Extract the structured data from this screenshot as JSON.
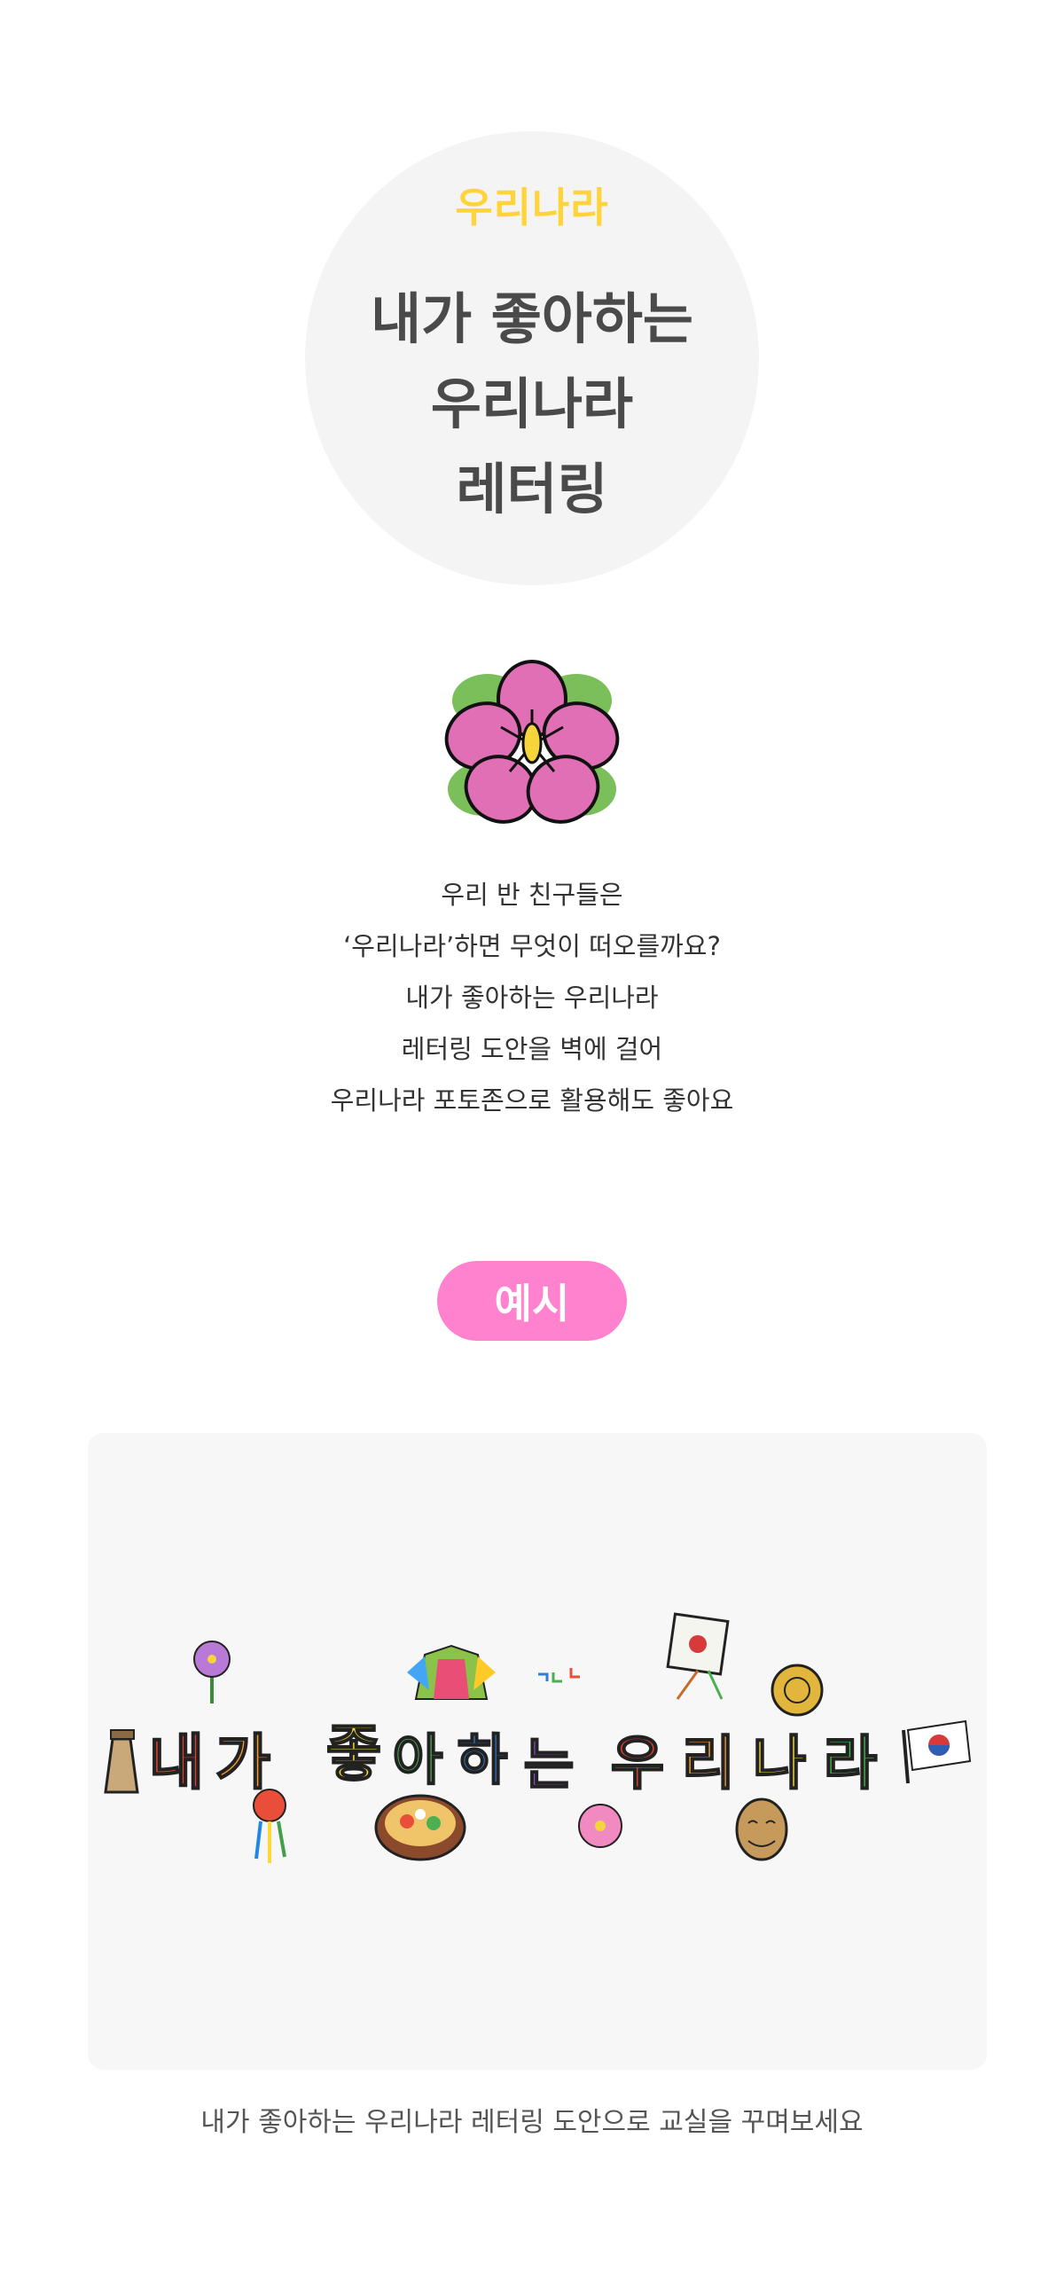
{
  "hero": {
    "subtitle": "우리나라",
    "title_lines": [
      "내가 좋아하는",
      "우리나라",
      "레터링"
    ]
  },
  "intro": {
    "lines": [
      "우리 반 친구들은",
      "‘우리나라’하면 무엇이 떠오를까요?",
      "내가 좋아하는 우리나라",
      "레터링 도안을 벽에 걸어",
      "우리나라 포토존으로 활용해도 좋아요"
    ]
  },
  "example": {
    "badge_label": "예시",
    "lettering_chars": [
      "내",
      "가",
      "좋",
      "아",
      "하",
      "는",
      "우",
      "리",
      "나",
      "라"
    ],
    "lettering_colors": [
      "#e8412f",
      "#f39b2e",
      "#f6d93a",
      "#4db653",
      "#2f7fd6",
      "#8a4fc6"
    ]
  },
  "caption": "내가 좋아하는 우리나라 레터링 도안으로 교실을 꾸며보세요",
  "colors": {
    "accent_yellow": "#ffd43b",
    "accent_pink": "#ff82cf",
    "panel_bg": "#f7f7f7",
    "hero_bg": "#f4f4f4"
  }
}
